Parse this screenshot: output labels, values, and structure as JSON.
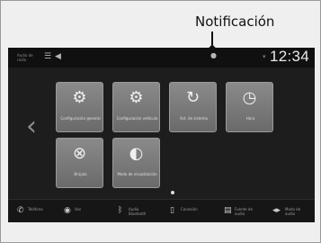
{
  "callout": {
    "label": "Notificación"
  },
  "status": {
    "left_label": "Audio de radio",
    "clock": "12:34"
  },
  "home": {
    "tiles": [
      {
        "label": "Configuración general",
        "icon": "gear-icon"
      },
      {
        "label": "Configuración vehículo",
        "icon": "car-settings-icon"
      },
      {
        "label": "Act. de sistema",
        "icon": "refresh-icon"
      },
      {
        "label": "Hora",
        "icon": "clock-icon"
      },
      {
        "label": "Brújula",
        "icon": "compass-icon"
      },
      {
        "label": "Modo de visualización",
        "icon": "display-mode-icon"
      }
    ]
  },
  "bottom": {
    "items": [
      {
        "label": "Teléfono",
        "icon": "phone-icon"
      },
      {
        "label": "Voz",
        "icon": "voice-icon"
      },
      {
        "label": "Audio Bluetooth",
        "icon": "bluetooth-icon"
      },
      {
        "label": "Conexión",
        "icon": "smartphone-icon"
      },
      {
        "label": "Fuente de audio",
        "icon": "audio-source-icon"
      },
      {
        "label": "Modo de audio",
        "icon": "audio-mode-icon"
      }
    ]
  }
}
